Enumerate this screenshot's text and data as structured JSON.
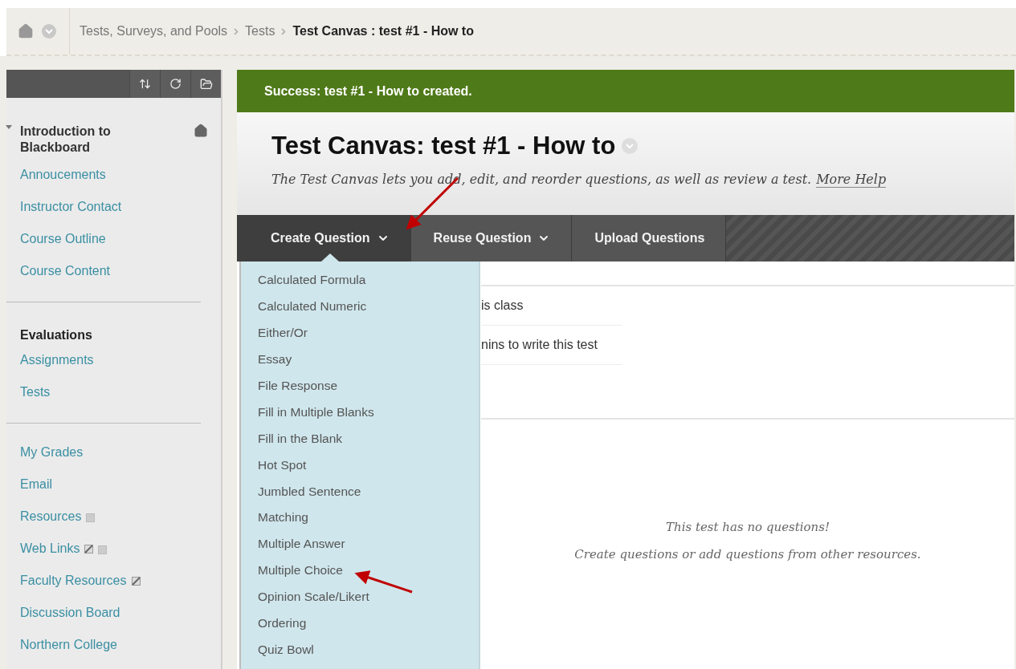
{
  "breadcrumbs": [
    {
      "label": "Tests, Surveys, and Pools",
      "current": false
    },
    {
      "label": "Tests",
      "current": false
    },
    {
      "label": "Test Canvas : test #1 - How to",
      "current": true
    }
  ],
  "sidebar": {
    "course": {
      "title": "Introduction to Blackboard",
      "expanded": true
    },
    "sections": [
      {
        "items": [
          {
            "label": "Annoucements"
          },
          {
            "label": "Instructor Contact"
          },
          {
            "label": "Course Outline"
          },
          {
            "label": "Course Content"
          }
        ]
      },
      {
        "title": "Evaluations",
        "items": [
          {
            "label": "Assignments"
          },
          {
            "label": "Tests"
          }
        ]
      },
      {
        "items": [
          {
            "label": "My Grades"
          },
          {
            "label": "Email"
          },
          {
            "label": "Resources",
            "icons": [
              {
                "kind": "square"
              }
            ]
          },
          {
            "label": "Web Links",
            "icons": [
              {
                "kind": "slashed"
              },
              {
                "kind": "square"
              }
            ]
          },
          {
            "label": "Faculty Resources",
            "icons": [
              {
                "kind": "slashed"
              }
            ]
          },
          {
            "label": "Discussion Board"
          },
          {
            "label": "Northern College"
          }
        ]
      }
    ]
  },
  "success_message": "Success: test #1 - How to created.",
  "page_title": "Test Canvas: test #1 - How to",
  "description": {
    "text": "The Test Canvas lets you add, edit, and reorder questions, as well as review a test.",
    "link": "More Help"
  },
  "action_tabs": [
    {
      "label": "Create Question",
      "selected": true,
      "dropdown": true
    },
    {
      "label": "Reuse Question",
      "selected": false,
      "dropdown": true
    },
    {
      "label": "Upload Questions",
      "selected": false,
      "dropdown": false
    }
  ],
  "question_types": [
    "Calculated Formula",
    "Calculated Numeric",
    "Either/Or",
    "Essay",
    "File Response",
    "Fill in Multiple Blanks",
    "Fill in the Blank",
    "Hot Spot",
    "Jumbled Sentence",
    "Matching",
    "Multiple Answer",
    "Multiple Choice",
    "Opinion Scale/Likert",
    "Ordering",
    "Quiz Bowl"
  ],
  "info_rows": [
    "is class",
    "nins to write this test"
  ],
  "empty_state": [
    "This test has no questions!",
    "Create questions or add questions from other resources."
  ]
}
